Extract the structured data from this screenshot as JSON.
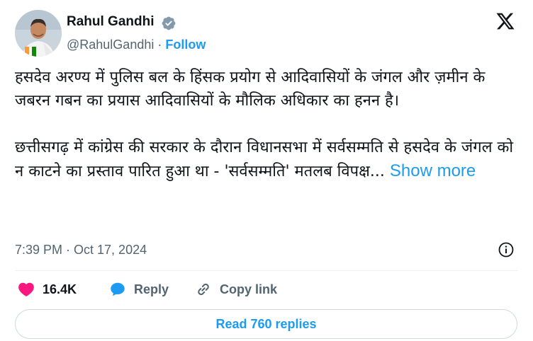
{
  "author": {
    "name": "Rahul Gandhi",
    "handle": "@RahulGandhi",
    "separator": "·",
    "follow_label": "Follow"
  },
  "tweet": {
    "paragraph1": "हसदेव अरण्य में पुलिस बल के हिंसक प्रयोग से आदिवासियों के जंगल और ज़मीन के जबरन गबन का प्रयास आदिवासियों के मौलिक अधिकार का हनन है।",
    "paragraph2": "छत्तीसगढ़ में कांग्रेस की सरकार के दौरान विधानसभा में सर्वसम्मति से हसदेव के जंगल को न काटने का प्रस्ताव पारित हुआ था - 'सर्वसम्मति' मतलब विपक्ष...",
    "show_more_label": "Show more"
  },
  "timestamp": "7:39 PM · Oct 17, 2024",
  "actions": {
    "like_count": "16.4K",
    "reply_label": "Reply",
    "copy_link_label": "Copy link"
  },
  "read_replies_label": "Read 760 replies",
  "colors": {
    "accent": "#1d9bf0",
    "like": "#f91880",
    "text": "#0f1419",
    "muted": "#536471",
    "verified": "#829aab"
  },
  "icons": [
    "verified-badge-icon",
    "x-logo-icon",
    "info-icon",
    "heart-icon",
    "reply-bubble-icon",
    "link-icon"
  ]
}
